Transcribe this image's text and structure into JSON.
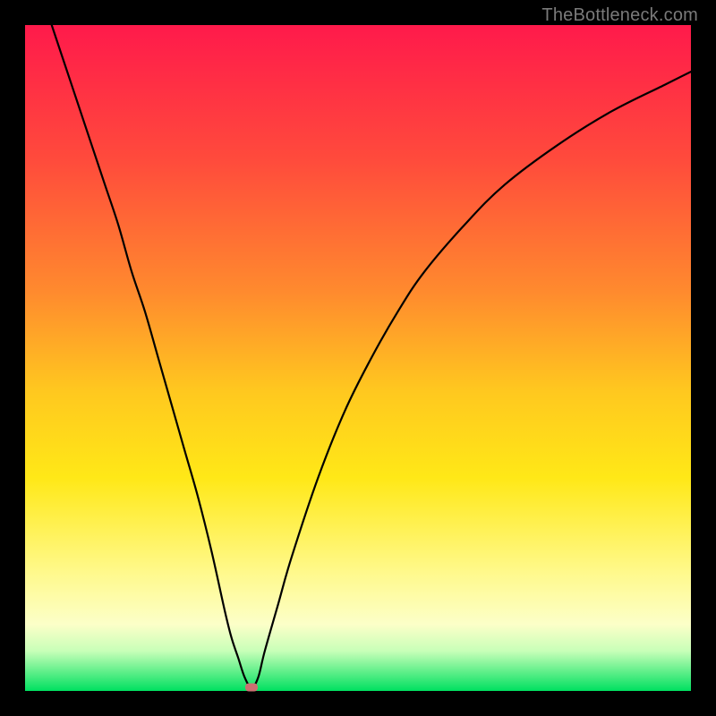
{
  "watermark": "TheBottleneck.com",
  "colors": {
    "background": "#000000",
    "curve": "#000000",
    "marker": "#cc6f71"
  },
  "chart_data": {
    "type": "line",
    "title": "",
    "xlabel": "",
    "ylabel": "",
    "xlim": [
      0,
      100
    ],
    "ylim": [
      0,
      100
    ],
    "grid": false,
    "legend": false,
    "series": [
      {
        "name": "bottleneck-curve",
        "x": [
          4,
          6,
          8,
          10,
          12,
          14,
          16,
          18,
          20,
          22,
          24,
          26,
          28,
          30,
          31,
          32,
          33,
          34,
          35,
          36,
          38,
          40,
          44,
          48,
          52,
          56,
          60,
          66,
          72,
          80,
          88,
          96,
          100
        ],
        "y": [
          100,
          94,
          88,
          82,
          76,
          70,
          63,
          57,
          50,
          43,
          36,
          29,
          21,
          12,
          8,
          5,
          2,
          0.5,
          2,
          6,
          13,
          20,
          32,
          42,
          50,
          57,
          63,
          70,
          76,
          82,
          87,
          91,
          93
        ]
      }
    ],
    "marker": {
      "x": 34,
      "y": 0.5
    },
    "gradient_stops": [
      {
        "pos": 0,
        "color": "#ff1a4b"
      },
      {
        "pos": 20,
        "color": "#ff4a3c"
      },
      {
        "pos": 40,
        "color": "#ff8a2e"
      },
      {
        "pos": 55,
        "color": "#ffc81f"
      },
      {
        "pos": 68,
        "color": "#ffe817"
      },
      {
        "pos": 82,
        "color": "#fff98a"
      },
      {
        "pos": 90,
        "color": "#fcffc8"
      },
      {
        "pos": 94,
        "color": "#c8ffb8"
      },
      {
        "pos": 100,
        "color": "#00e060"
      }
    ]
  }
}
